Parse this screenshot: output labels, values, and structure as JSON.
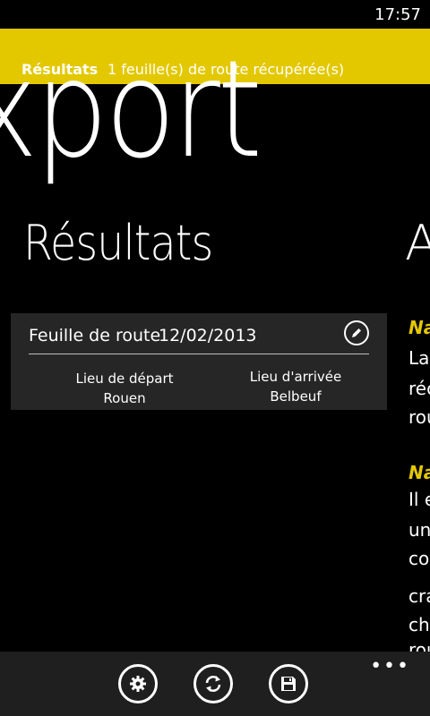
{
  "status_bar": {
    "time": "17:57"
  },
  "banner": {
    "title": "Résultats",
    "message": "1 feuille(s) de route récupérée(s)",
    "color": "#e3c800"
  },
  "panorama": {
    "title": "xport",
    "section_header": "Résultats",
    "next_section_header": "A"
  },
  "card": {
    "label": "Feuille de route",
    "date": "12/02/2013",
    "edit_icon": "edit-pencil-icon",
    "departure_label": "Lieu de départ",
    "departure_value": "Rouen",
    "arrival_label": "Lieu d'arrivée",
    "arrival_value": "Belbeuf"
  },
  "next_panel": {
    "lines": [
      {
        "text": "Na",
        "style": "heading"
      },
      {
        "text": "La",
        "style": "body"
      },
      {
        "text": "réc",
        "style": "body"
      },
      {
        "text": "rou",
        "style": "body"
      },
      {
        "text": "Na",
        "style": "heading"
      },
      {
        "text": "Il e",
        "style": "body"
      },
      {
        "text": "un",
        "style": "body"
      },
      {
        "text": "co",
        "style": "body"
      },
      {
        "text": "cra",
        "style": "body"
      },
      {
        "text": "ch",
        "style": "body"
      },
      {
        "text": "rou",
        "style": "body"
      }
    ]
  },
  "app_bar": {
    "buttons": [
      {
        "name": "settings",
        "icon": "gear-icon"
      },
      {
        "name": "refresh",
        "icon": "refresh-icon"
      },
      {
        "name": "save",
        "icon": "save-icon"
      }
    ],
    "more": "•••"
  }
}
